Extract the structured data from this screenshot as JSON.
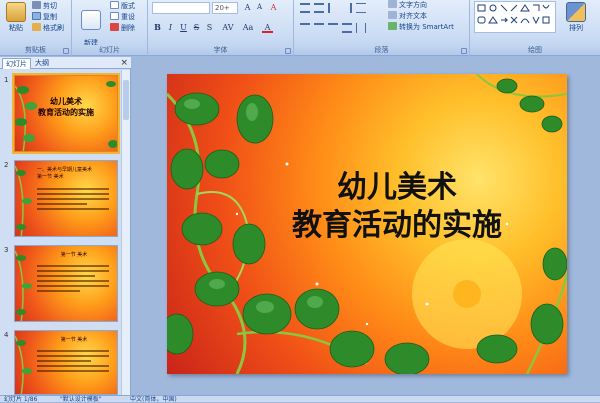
{
  "ribbon": {
    "clipboard": {
      "label": "剪贴板",
      "paste": "粘贴",
      "cut": "剪切",
      "copy": "复制",
      "format_painter": "格式刷"
    },
    "slides": {
      "label": "幻灯片",
      "new_slide": "新建\n幻灯片",
      "layout": "版式",
      "reset": "重设",
      "delete": "删除"
    },
    "font": {
      "label": "字体",
      "size": "20+"
    },
    "paragraph": {
      "label": "段落",
      "text_direction": "文字方向",
      "align_text": "对齐文本",
      "smartart": "转换为 SmartArt"
    },
    "drawing": {
      "label": "绘图",
      "arrange": "排列"
    }
  },
  "pane": {
    "tabs": [
      "幻灯片",
      "大纲"
    ],
    "thumbs": [
      {
        "num": "1",
        "title": "幼儿美术\n教育活动的实施"
      },
      {
        "num": "2",
        "sub": "一、美术与早期儿童美术\n第一节 美术",
        "lines": 5
      },
      {
        "num": "3",
        "sub": "第一节 美术",
        "lines": 6
      },
      {
        "num": "4",
        "sub": "第一节 美术",
        "lines": 6
      }
    ]
  },
  "slide": {
    "title_line1": "幼儿美术",
    "title_line2": "教育活动的实施"
  },
  "status": {
    "slide_count": "幻灯片 1/86",
    "theme": "\"默认设计模板\"",
    "language": "中文(简体，中国)"
  },
  "colors": {
    "ribbon_bg": "#c9dbf3",
    "app_bg": "#9fb8dc",
    "leaf": "#2d8b2a",
    "vine": "#8cc63f"
  }
}
